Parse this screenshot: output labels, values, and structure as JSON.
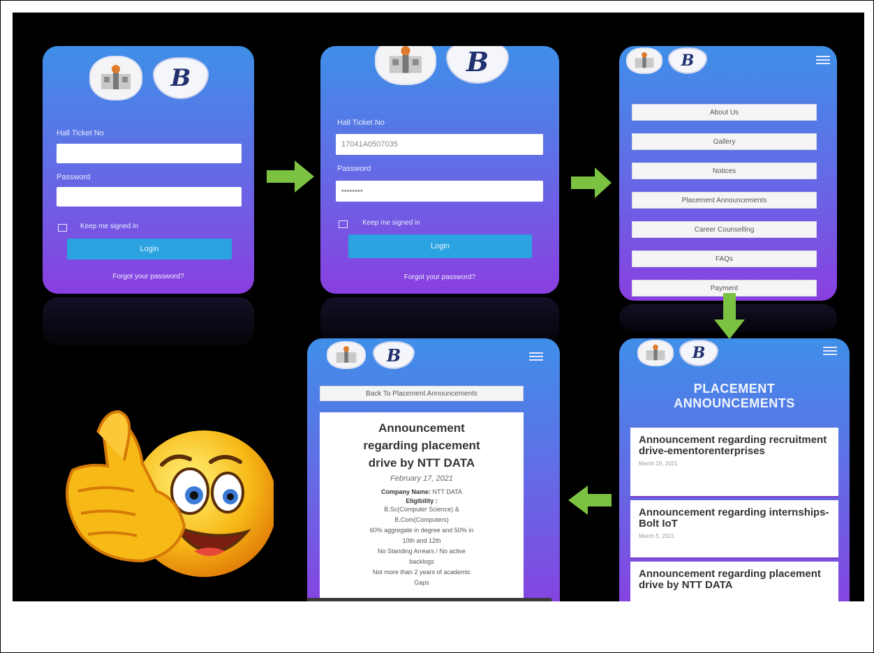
{
  "screen1": {
    "hall_ticket_label": "Hall Ticket No",
    "password_label": "Password",
    "keep_signed_in": "Keep me signed in",
    "login": "Login",
    "forgot": "Forgot your password?"
  },
  "screen2": {
    "hall_ticket_label": "Hall Ticket No",
    "hall_ticket_value": "17041A0507035",
    "password_label": "Password",
    "password_value": "••••••••",
    "keep_signed_in": "Keep me signed in",
    "login": "Login",
    "forgot": "Forgot your password?"
  },
  "screen3": {
    "menu": [
      "About Us",
      "Gallery",
      "Notices",
      "Placement Announcements",
      "Career Counselling",
      "FAQs",
      "Payment"
    ]
  },
  "screen4": {
    "title_line1": "PLACEMENT",
    "title_line2": "ANNOUNCEMENTS",
    "items": [
      {
        "title": "Announcement regarding recruitment drive-ementorenterprises",
        "date": "March 19, 2021"
      },
      {
        "title": "Announcement regarding internships- Bolt IoT",
        "date": "March 5, 2021"
      },
      {
        "title": "Announcement regarding placement drive by NTT DATA",
        "date": ""
      }
    ]
  },
  "screen5": {
    "back": "Back To Placement Announcements",
    "heading_l1": "Announcement",
    "heading_l2": "regarding placement",
    "heading_l3": "drive by NTT DATA",
    "date": "February 17, 2021",
    "company_label": "Company Name:",
    "company_value": "NTT DATA",
    "eligibility_label": "Eligibility :",
    "e1": "B.Sc(Computer Science) &",
    "e2": "B.Com(Computers)",
    "e3": "60% aggregate in degree and 50% in",
    "e4": "10th and 12th",
    "e5": "No Standing Arrears / No active",
    "e6": "backlogs",
    "e7": "Not more than 2 years of academic",
    "e8": "Gaps"
  },
  "colors": {
    "gradient_top": "#3f8fe8",
    "gradient_bottom": "#8a3fe0",
    "login_button": "#2aa3e0",
    "arrow": "#7cc242"
  }
}
